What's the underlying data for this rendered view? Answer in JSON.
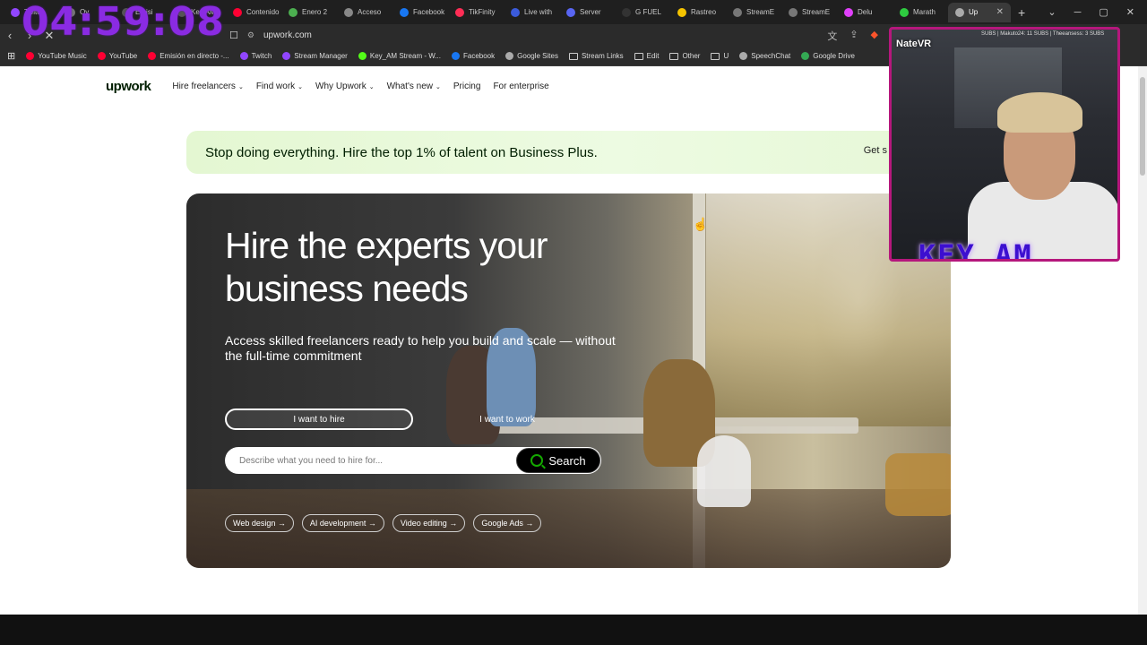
{
  "timer": "04:59:08",
  "tabs": [
    {
      "title": "Twitch",
      "color": "#9146ff"
    },
    {
      "title": "Ov",
      "color": "#777777"
    },
    {
      "title": "Emisi",
      "color": "#555555"
    },
    {
      "title": "Key AM",
      "color": "#555555"
    },
    {
      "title": "Contenido",
      "color": "#ff0033"
    },
    {
      "title": "Enero 2",
      "color": "#4caf50"
    },
    {
      "title": "Acceso",
      "color": "#888888"
    },
    {
      "title": "Facebook",
      "color": "#1877f2"
    },
    {
      "title": "TikFinity",
      "color": "#ff2d55"
    },
    {
      "title": "Live with",
      "color": "#3b5bdb"
    },
    {
      "title": "Server",
      "color": "#5865f2"
    },
    {
      "title": "G FUEL",
      "color": "#333333"
    },
    {
      "title": "Rastreo",
      "color": "#f5c400"
    },
    {
      "title": "StreamE",
      "color": "#777777"
    },
    {
      "title": "StreamE",
      "color": "#777777"
    },
    {
      "title": "Delu",
      "color": "#e040fb"
    },
    {
      "title": "Marath",
      "color": "#2ecc40"
    },
    {
      "title": "Up",
      "color": "#aaaaaa",
      "active": true
    }
  ],
  "address": {
    "url": "upwork.com"
  },
  "bookmarks": [
    {
      "label": "YouTube Music",
      "color": "#ff0033",
      "type": "site"
    },
    {
      "label": "YouTube",
      "color": "#ff0033",
      "type": "site"
    },
    {
      "label": "Emisión en directo -...",
      "color": "#ff0033",
      "type": "site"
    },
    {
      "label": "Twitch",
      "color": "#9146ff",
      "type": "site"
    },
    {
      "label": "Stream Manager",
      "color": "#9146ff",
      "type": "site"
    },
    {
      "label": "Key_AM Stream - W...",
      "color": "#53fc18",
      "type": "site"
    },
    {
      "label": "Facebook",
      "color": "#1877f2",
      "type": "site"
    },
    {
      "label": "Google Sites",
      "color": "#aaaaaa",
      "type": "site"
    },
    {
      "label": "Stream Links",
      "type": "folder"
    },
    {
      "label": "Edit",
      "type": "folder"
    },
    {
      "label": "Other",
      "type": "folder"
    },
    {
      "label": "U",
      "type": "folder"
    },
    {
      "label": "SpeechChat",
      "color": "#aaaaaa",
      "type": "site"
    },
    {
      "label": "Google Drive",
      "color": "#34a853",
      "type": "site"
    }
  ],
  "header": {
    "logo": "upwork",
    "menu": [
      "Hire freelancers",
      "Find work",
      "Why Upwork",
      "What's new",
      "Pricing",
      "For enterprise"
    ]
  },
  "banner": {
    "text": "Stop doing everything. Hire the top 1% of talent on Business Plus.",
    "cta": "Get s"
  },
  "hero": {
    "title": "Hire the experts your business needs",
    "subtitle": "Access skilled freelancers ready to help you build and scale — without the full-time commitment",
    "toggle_hire": "I want to hire",
    "toggle_work": "I want to work",
    "search_placeholder": "Describe what you need to hire for...",
    "search_button": "Search",
    "chips": [
      "Web design →",
      "AI development →",
      "Video editing →",
      "Google Ads →"
    ]
  },
  "webcam": {
    "overlay_name": "KEY_AM",
    "overlay_small": "NateVR",
    "ticker": "SUBS | Makuto24: 11 SUBS | Theeansess: 3 SUBS"
  },
  "colors": {
    "brand_green": "#14a800",
    "timer": "#8a2be2",
    "webcam_border": "#b5177c"
  }
}
